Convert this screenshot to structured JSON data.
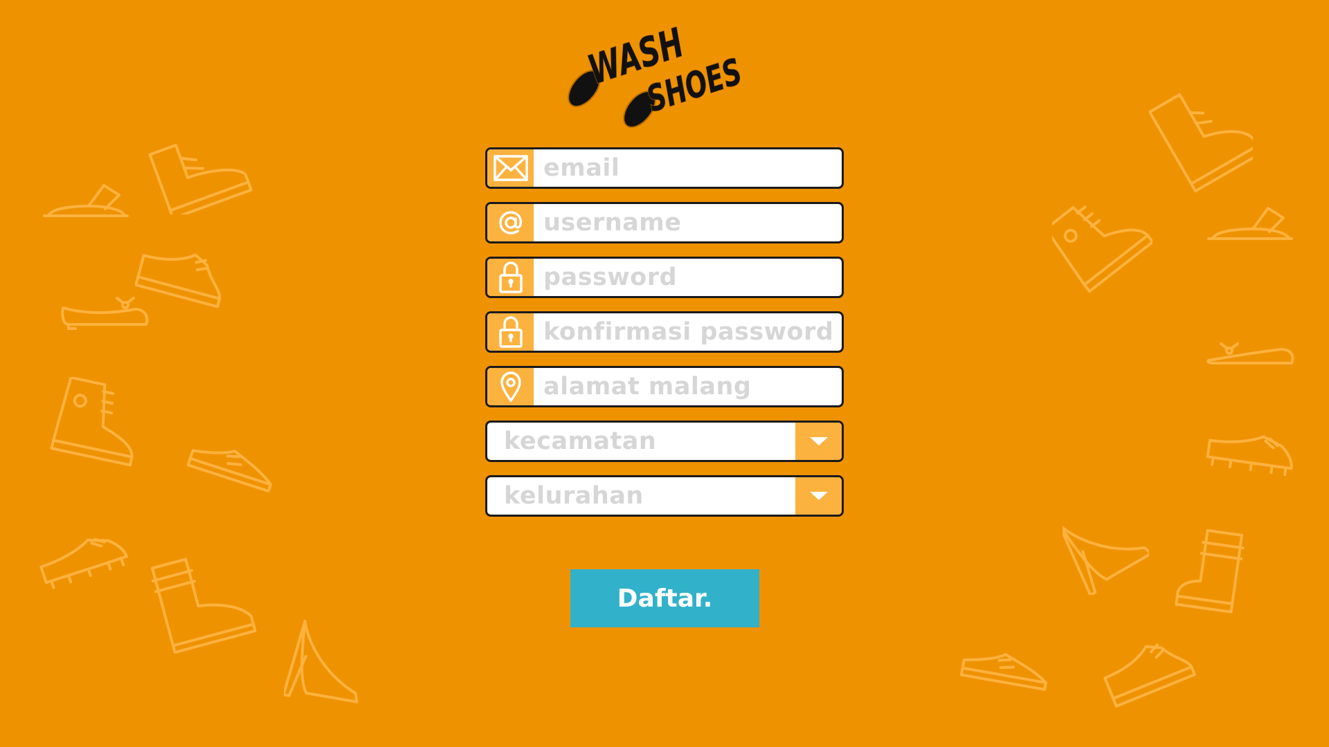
{
  "logo": {
    "word1": "WASH",
    "word2": "SHOES"
  },
  "form": {
    "email": {
      "placeholder": "email",
      "icon": "envelope-icon"
    },
    "username": {
      "placeholder": "username",
      "icon": "at-sign-icon"
    },
    "password": {
      "placeholder": "password",
      "icon": "lock-icon"
    },
    "confirm_password": {
      "placeholder": "konfirmasi password",
      "icon": "lock-icon"
    },
    "address": {
      "placeholder": "alamat malang",
      "icon": "map-pin-icon"
    },
    "kecamatan": {
      "label": "kecamatan",
      "icon": "caret-down-icon"
    },
    "kelurahan": {
      "label": "kelurahan",
      "icon": "caret-down-icon"
    },
    "submit_label": "Daftar."
  },
  "colors": {
    "background": "#ef9200",
    "accent": "#fcb23f",
    "button": "#32b1cb",
    "placeholder": "#d6d6d6"
  }
}
